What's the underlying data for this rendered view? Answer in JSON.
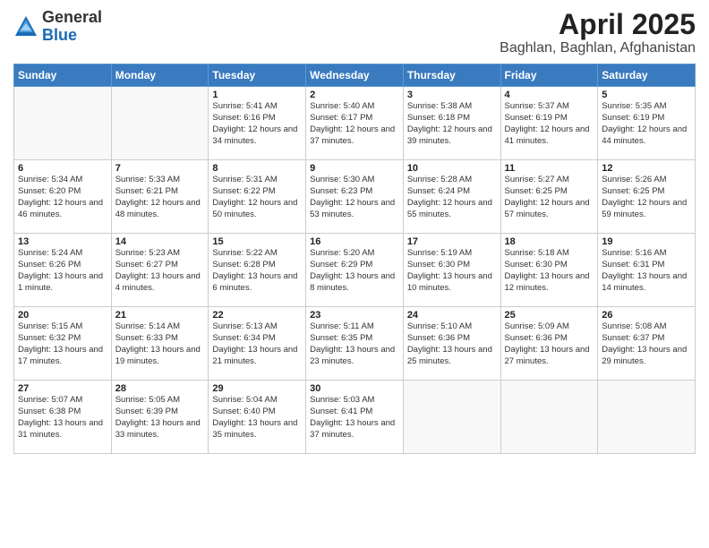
{
  "header": {
    "logo_general": "General",
    "logo_blue": "Blue",
    "month": "April 2025",
    "location": "Baghlan, Baghlan, Afghanistan"
  },
  "days_of_week": [
    "Sunday",
    "Monday",
    "Tuesday",
    "Wednesday",
    "Thursday",
    "Friday",
    "Saturday"
  ],
  "weeks": [
    [
      {
        "day": "",
        "info": ""
      },
      {
        "day": "",
        "info": ""
      },
      {
        "day": "1",
        "info": "Sunrise: 5:41 AM\nSunset: 6:16 PM\nDaylight: 12 hours and 34 minutes."
      },
      {
        "day": "2",
        "info": "Sunrise: 5:40 AM\nSunset: 6:17 PM\nDaylight: 12 hours and 37 minutes."
      },
      {
        "day": "3",
        "info": "Sunrise: 5:38 AM\nSunset: 6:18 PM\nDaylight: 12 hours and 39 minutes."
      },
      {
        "day": "4",
        "info": "Sunrise: 5:37 AM\nSunset: 6:19 PM\nDaylight: 12 hours and 41 minutes."
      },
      {
        "day": "5",
        "info": "Sunrise: 5:35 AM\nSunset: 6:19 PM\nDaylight: 12 hours and 44 minutes."
      }
    ],
    [
      {
        "day": "6",
        "info": "Sunrise: 5:34 AM\nSunset: 6:20 PM\nDaylight: 12 hours and 46 minutes."
      },
      {
        "day": "7",
        "info": "Sunrise: 5:33 AM\nSunset: 6:21 PM\nDaylight: 12 hours and 48 minutes."
      },
      {
        "day": "8",
        "info": "Sunrise: 5:31 AM\nSunset: 6:22 PM\nDaylight: 12 hours and 50 minutes."
      },
      {
        "day": "9",
        "info": "Sunrise: 5:30 AM\nSunset: 6:23 PM\nDaylight: 12 hours and 53 minutes."
      },
      {
        "day": "10",
        "info": "Sunrise: 5:28 AM\nSunset: 6:24 PM\nDaylight: 12 hours and 55 minutes."
      },
      {
        "day": "11",
        "info": "Sunrise: 5:27 AM\nSunset: 6:25 PM\nDaylight: 12 hours and 57 minutes."
      },
      {
        "day": "12",
        "info": "Sunrise: 5:26 AM\nSunset: 6:25 PM\nDaylight: 12 hours and 59 minutes."
      }
    ],
    [
      {
        "day": "13",
        "info": "Sunrise: 5:24 AM\nSunset: 6:26 PM\nDaylight: 13 hours and 1 minute."
      },
      {
        "day": "14",
        "info": "Sunrise: 5:23 AM\nSunset: 6:27 PM\nDaylight: 13 hours and 4 minutes."
      },
      {
        "day": "15",
        "info": "Sunrise: 5:22 AM\nSunset: 6:28 PM\nDaylight: 13 hours and 6 minutes."
      },
      {
        "day": "16",
        "info": "Sunrise: 5:20 AM\nSunset: 6:29 PM\nDaylight: 13 hours and 8 minutes."
      },
      {
        "day": "17",
        "info": "Sunrise: 5:19 AM\nSunset: 6:30 PM\nDaylight: 13 hours and 10 minutes."
      },
      {
        "day": "18",
        "info": "Sunrise: 5:18 AM\nSunset: 6:30 PM\nDaylight: 13 hours and 12 minutes."
      },
      {
        "day": "19",
        "info": "Sunrise: 5:16 AM\nSunset: 6:31 PM\nDaylight: 13 hours and 14 minutes."
      }
    ],
    [
      {
        "day": "20",
        "info": "Sunrise: 5:15 AM\nSunset: 6:32 PM\nDaylight: 13 hours and 17 minutes."
      },
      {
        "day": "21",
        "info": "Sunrise: 5:14 AM\nSunset: 6:33 PM\nDaylight: 13 hours and 19 minutes."
      },
      {
        "day": "22",
        "info": "Sunrise: 5:13 AM\nSunset: 6:34 PM\nDaylight: 13 hours and 21 minutes."
      },
      {
        "day": "23",
        "info": "Sunrise: 5:11 AM\nSunset: 6:35 PM\nDaylight: 13 hours and 23 minutes."
      },
      {
        "day": "24",
        "info": "Sunrise: 5:10 AM\nSunset: 6:36 PM\nDaylight: 13 hours and 25 minutes."
      },
      {
        "day": "25",
        "info": "Sunrise: 5:09 AM\nSunset: 6:36 PM\nDaylight: 13 hours and 27 minutes."
      },
      {
        "day": "26",
        "info": "Sunrise: 5:08 AM\nSunset: 6:37 PM\nDaylight: 13 hours and 29 minutes."
      }
    ],
    [
      {
        "day": "27",
        "info": "Sunrise: 5:07 AM\nSunset: 6:38 PM\nDaylight: 13 hours and 31 minutes."
      },
      {
        "day": "28",
        "info": "Sunrise: 5:05 AM\nSunset: 6:39 PM\nDaylight: 13 hours and 33 minutes."
      },
      {
        "day": "29",
        "info": "Sunrise: 5:04 AM\nSunset: 6:40 PM\nDaylight: 13 hours and 35 minutes."
      },
      {
        "day": "30",
        "info": "Sunrise: 5:03 AM\nSunset: 6:41 PM\nDaylight: 13 hours and 37 minutes."
      },
      {
        "day": "",
        "info": ""
      },
      {
        "day": "",
        "info": ""
      },
      {
        "day": "",
        "info": ""
      }
    ]
  ]
}
